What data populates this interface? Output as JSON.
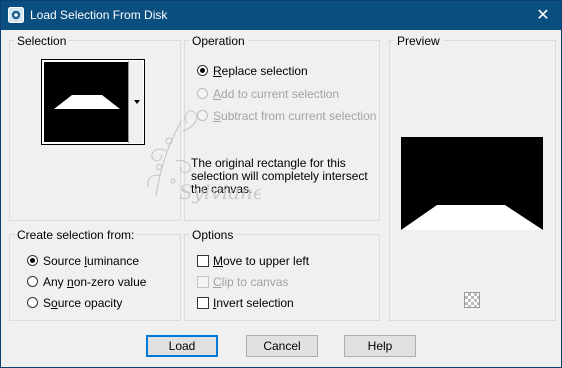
{
  "window": {
    "title": "Load Selection From Disk",
    "close_glyph": "✕",
    "app_icon": "photo-app-icon"
  },
  "selection": {
    "group_title": "Selection"
  },
  "operation": {
    "group_title": "Operation",
    "options": [
      {
        "label_u": "R",
        "label_rest": "eplace selection",
        "checked": true,
        "enabled": true
      },
      {
        "label_u": "A",
        "label_rest": "dd to current selection",
        "checked": false,
        "enabled": false
      },
      {
        "label_u": "S",
        "label_rest": "ubtract from current selection",
        "checked": false,
        "enabled": false
      }
    ],
    "info_text": "The original rectangle for this selection will completely intersect the canvas."
  },
  "preview": {
    "group_title": "Preview",
    "checker_icon": "transparency-checker-icon"
  },
  "create_from": {
    "group_title": "Create selection from:",
    "options": [
      {
        "label_pre": "Source ",
        "label_u": "l",
        "label_rest": "uminance",
        "checked": true
      },
      {
        "label_pre": "Any ",
        "label_u": "n",
        "label_rest": "on-zero value",
        "checked": false
      },
      {
        "label_pre": "S",
        "label_u": "o",
        "label_rest": "urce opacity",
        "checked": false
      }
    ]
  },
  "options": {
    "group_title": "Options",
    "items": [
      {
        "label_u": "M",
        "label_rest": "ove to upper left",
        "checked": false,
        "enabled": true
      },
      {
        "label_u": "C",
        "label_rest": "lip to canvas",
        "checked": false,
        "enabled": false
      },
      {
        "label_u": "I",
        "label_rest": "nvert selection",
        "checked": false,
        "enabled": true
      }
    ]
  },
  "buttons": {
    "load": "Load",
    "cancel": "Cancel",
    "help": "Help"
  },
  "watermark": {
    "text": "Sylviane"
  },
  "colors": {
    "titlebar": "#0b4f80",
    "focus_border": "#0078d7"
  }
}
